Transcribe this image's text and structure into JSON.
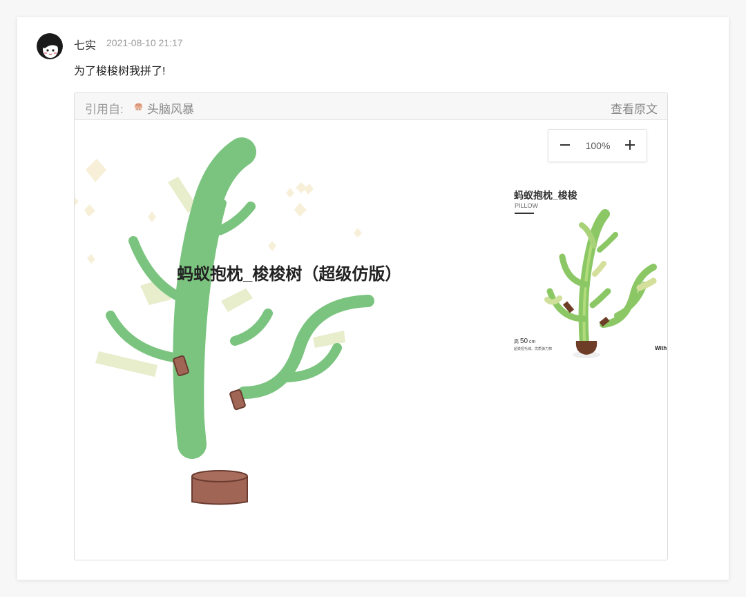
{
  "post": {
    "author": "七实",
    "time": "2021-08-10 21:17",
    "comment": "为了梭梭树我拼了!"
  },
  "quote": {
    "prefix": "引用自:",
    "board_name": "头脑风暴",
    "view_original": "查看原文"
  },
  "canvas": {
    "zoom_level": "100%",
    "title": "蚂蚁抱枕_梭梭树（超级仿版）",
    "product": {
      "title": "蚂蚁抱枕_梭梭",
      "subtitle": "PILLOW",
      "height_prefix": "高",
      "height_value": "50",
      "height_unit": "cm",
      "description": "超柔短毛绒、优质弹力棉",
      "trailing_text": "With"
    }
  },
  "colors": {
    "cactus_green": "#7bc47f",
    "pot_brown": "#a06555",
    "confetti_cream": "#f6eed8"
  }
}
